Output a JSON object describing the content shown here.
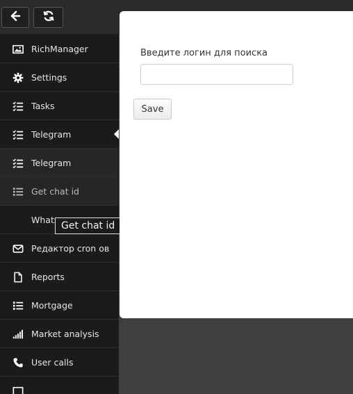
{
  "toolbar": {
    "back_icon": "arrow-left-icon",
    "refresh_icon": "refresh-icon"
  },
  "sidebar": {
    "items": [
      {
        "label": "RichManager",
        "icon": "image-icon"
      },
      {
        "label": "Settings",
        "icon": "gear-icon"
      },
      {
        "label": "Tasks",
        "icon": "checklist-icon"
      },
      {
        "label": "Telegram",
        "icon": "checklist-icon"
      },
      {
        "label": "Telegram",
        "icon": "checklist-icon"
      },
      {
        "label": "Get chat id",
        "icon": "list-icon"
      },
      {
        "label": "Whats",
        "icon": ""
      },
      {
        "label": "Редактор cron ов",
        "icon": "envelope-icon"
      },
      {
        "label": "Reports",
        "icon": "file-icon"
      },
      {
        "label": "Mortgage",
        "icon": "list-icon"
      },
      {
        "label": "Market analysis",
        "icon": "signal-bars-icon"
      },
      {
        "label": "User calls",
        "icon": "phone-icon"
      }
    ]
  },
  "tooltip": {
    "text": "Get chat id"
  },
  "form": {
    "label": "Введите логин для поиска",
    "input_value": "",
    "save_label": "Save"
  }
}
